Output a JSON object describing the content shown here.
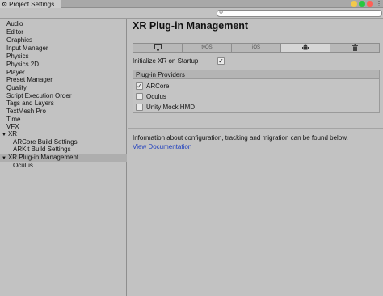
{
  "window": {
    "tab_title": "Project Settings",
    "traffic_colors": [
      "#f2c94c",
      "#27c93f",
      "#ff5f56"
    ]
  },
  "search": {
    "placeholder": "",
    "value": ""
  },
  "sidebar": {
    "items": [
      {
        "label": "Audio"
      },
      {
        "label": "Editor"
      },
      {
        "label": "Graphics"
      },
      {
        "label": "Input Manager"
      },
      {
        "label": "Physics"
      },
      {
        "label": "Physics 2D"
      },
      {
        "label": "Player"
      },
      {
        "label": "Preset Manager"
      },
      {
        "label": "Quality"
      },
      {
        "label": "Script Execution Order"
      },
      {
        "label": "Tags and Layers"
      },
      {
        "label": "TextMesh Pro"
      },
      {
        "label": "Time"
      },
      {
        "label": "VFX"
      },
      {
        "label": "XR",
        "expandable": true
      },
      {
        "label": "ARCore Build Settings",
        "child": true
      },
      {
        "label": "ARKit Build Settings",
        "child": true
      },
      {
        "label": "XR Plug-in Management",
        "expandable": true,
        "selected": true
      },
      {
        "label": "Oculus",
        "child": true
      }
    ]
  },
  "main": {
    "title": "XR Plug-in Management",
    "platform_tabs": [
      {
        "icon": "monitor-icon",
        "label": ""
      },
      {
        "icon": "",
        "label": "tvOS"
      },
      {
        "icon": "",
        "label": "iOS"
      },
      {
        "icon": "android-icon",
        "label": "",
        "active": true
      },
      {
        "icon": "trash-icon",
        "label": ""
      }
    ],
    "init_label": "Initialize XR on Startup",
    "init_checked": true,
    "providers_title": "Plug-in Providers",
    "providers": [
      {
        "label": "ARCore",
        "checked": true
      },
      {
        "label": "Oculus",
        "checked": false
      },
      {
        "label": "Unity Mock HMD",
        "checked": false
      }
    ],
    "info_text": "Information about configuration, tracking and migration can be found below.",
    "doc_link": "View Documentation"
  }
}
